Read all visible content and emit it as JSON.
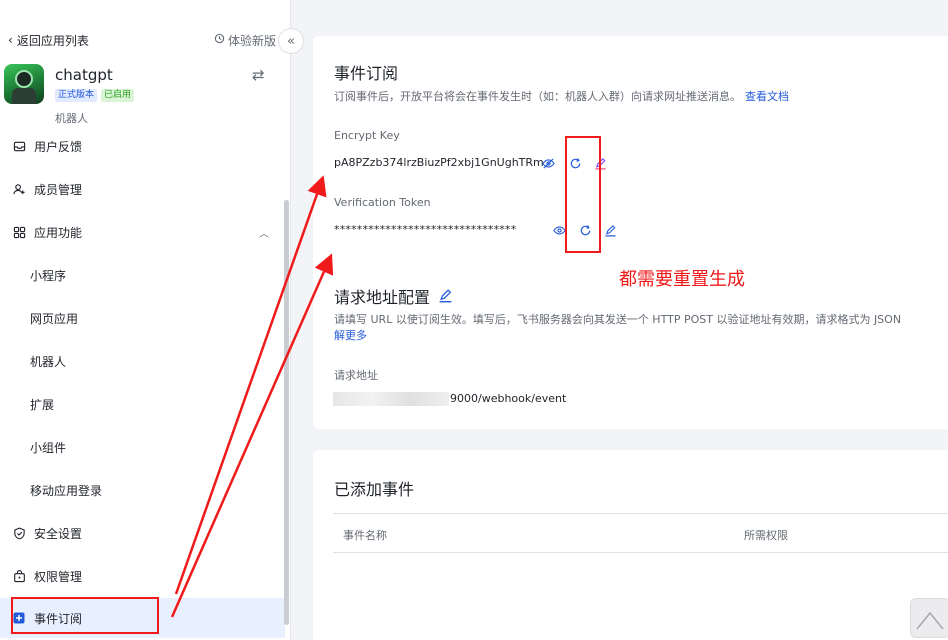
{
  "sidebar": {
    "back_label": "返回应用列表",
    "try_new_label": "体验新版",
    "app": {
      "name": "chatgpt",
      "badge_version": "正式版本",
      "badge_status": "已启用",
      "type": "机器人"
    },
    "items": [
      {
        "label": "用户反馈",
        "icon": "inbox-icon"
      },
      {
        "label": "成员管理",
        "icon": "user-add-icon"
      },
      {
        "label": "应用功能",
        "icon": "grid-icon"
      },
      {
        "label": "小程序"
      },
      {
        "label": "网页应用"
      },
      {
        "label": "机器人"
      },
      {
        "label": "扩展"
      },
      {
        "label": "小组件"
      },
      {
        "label": "移动应用登录"
      },
      {
        "label": "安全设置",
        "icon": "shield-icon"
      },
      {
        "label": "权限管理",
        "icon": "lock-icon"
      },
      {
        "label": "事件订阅",
        "icon": "event-icon",
        "active": true
      }
    ]
  },
  "event_sub": {
    "title": "事件订阅",
    "desc": "订阅事件后，开放平台将会在事件发生时（如：机器人入群）向请求网址推送消息。",
    "doc_link": "查看文档",
    "encrypt_label": "Encrypt Key",
    "encrypt_value": "pA8PZzb374lrzBiuzPf2xbj1GnUghTRm",
    "token_label": "Verification Token",
    "token_value": "********************************"
  },
  "request_config": {
    "title": "请求地址配置",
    "desc_line1": "请填写 URL 以使订阅生效。填写后，飞书服务器会向其发送一个 HTTP POST 以验证地址有效期，请求格式为 JSON",
    "desc_more": "解更多",
    "url_label": "请求地址",
    "url_value": "9000/webhook/event"
  },
  "added_events": {
    "title": "已添加事件",
    "columns": [
      "事件名称",
      "所需权限"
    ]
  },
  "annotation": {
    "text": "都需要重置生成",
    "color": "#f01a1a"
  },
  "colors": {
    "accent": "#245bdb",
    "active_bg": "#e8efff",
    "annotation": "#f01a1a"
  }
}
